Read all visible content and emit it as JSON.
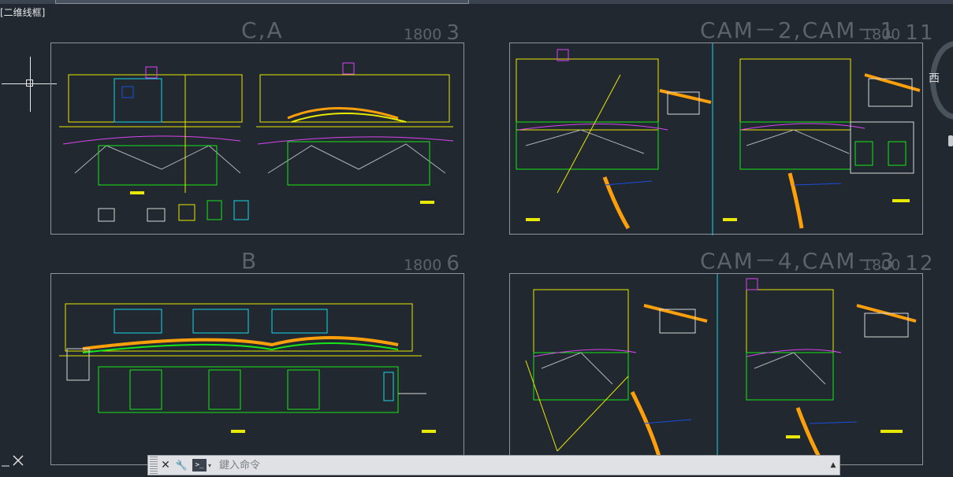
{
  "viewport": {
    "label": "[二维线框]"
  },
  "sheets": [
    {
      "title": "C,A",
      "scale": "1800",
      "number": "3"
    },
    {
      "title": "CAM－2,CAM－1",
      "scale": "1800",
      "number": "11"
    },
    {
      "title": "B",
      "scale": "1800",
      "number": "6"
    },
    {
      "title": "CAM－4,CAM－3",
      "scale": "1800",
      "number": "12"
    }
  ],
  "viewcube": {
    "direction_label": "西"
  },
  "command_line": {
    "close_glyph": "✕",
    "customize_glyph": "🔧",
    "prompt_glyph": ">_",
    "dropdown_glyph": "▾",
    "placeholder": "鍵入命令",
    "history_glyph": "▲"
  },
  "ucs": {
    "glyph": "✕"
  },
  "colors": {
    "background": "#212830",
    "accent_yellow": "#e8e800",
    "accent_green": "#19e619",
    "accent_magenta": "#d946ef",
    "accent_orange": "#ff9f0a",
    "accent_cyan": "#19d6e6",
    "accent_blue": "#1d4ed8"
  }
}
